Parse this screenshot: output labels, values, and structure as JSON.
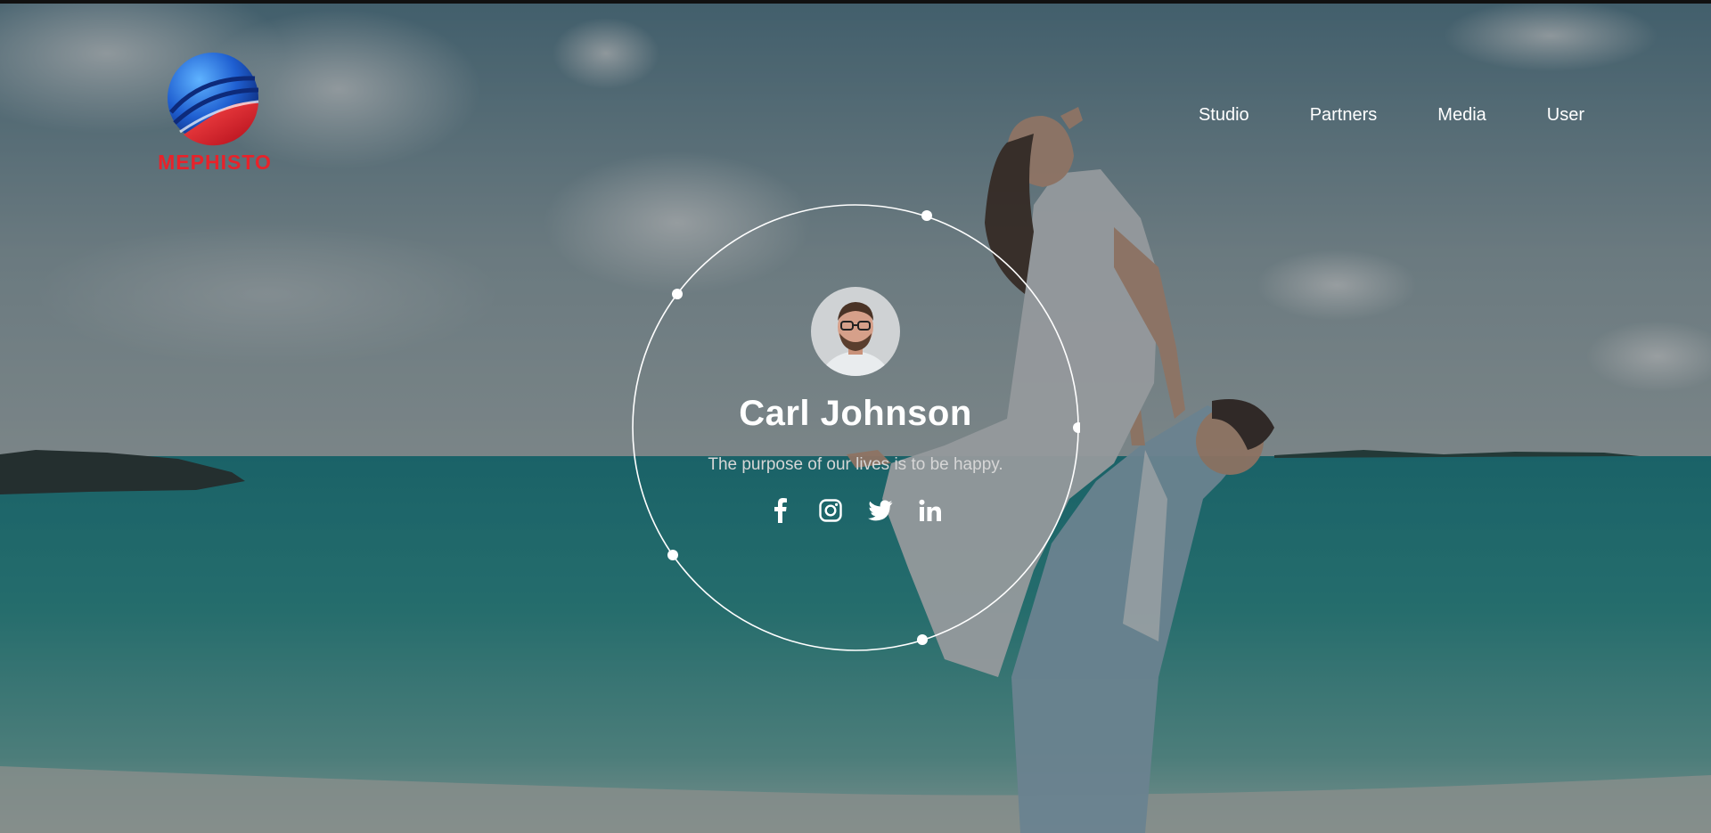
{
  "brand": {
    "name": "MEPHISTO",
    "color": "#e8222a"
  },
  "nav": {
    "items": [
      {
        "label": "Studio"
      },
      {
        "label": "Partners"
      },
      {
        "label": "Media"
      },
      {
        "label": "User"
      }
    ]
  },
  "profile": {
    "name": "Carl Johnson",
    "tagline": "The purpose of our lives is to be happy."
  },
  "socials": [
    {
      "icon": "facebook-icon"
    },
    {
      "icon": "instagram-icon"
    },
    {
      "icon": "twitter-icon"
    },
    {
      "icon": "linkedin-icon"
    }
  ]
}
